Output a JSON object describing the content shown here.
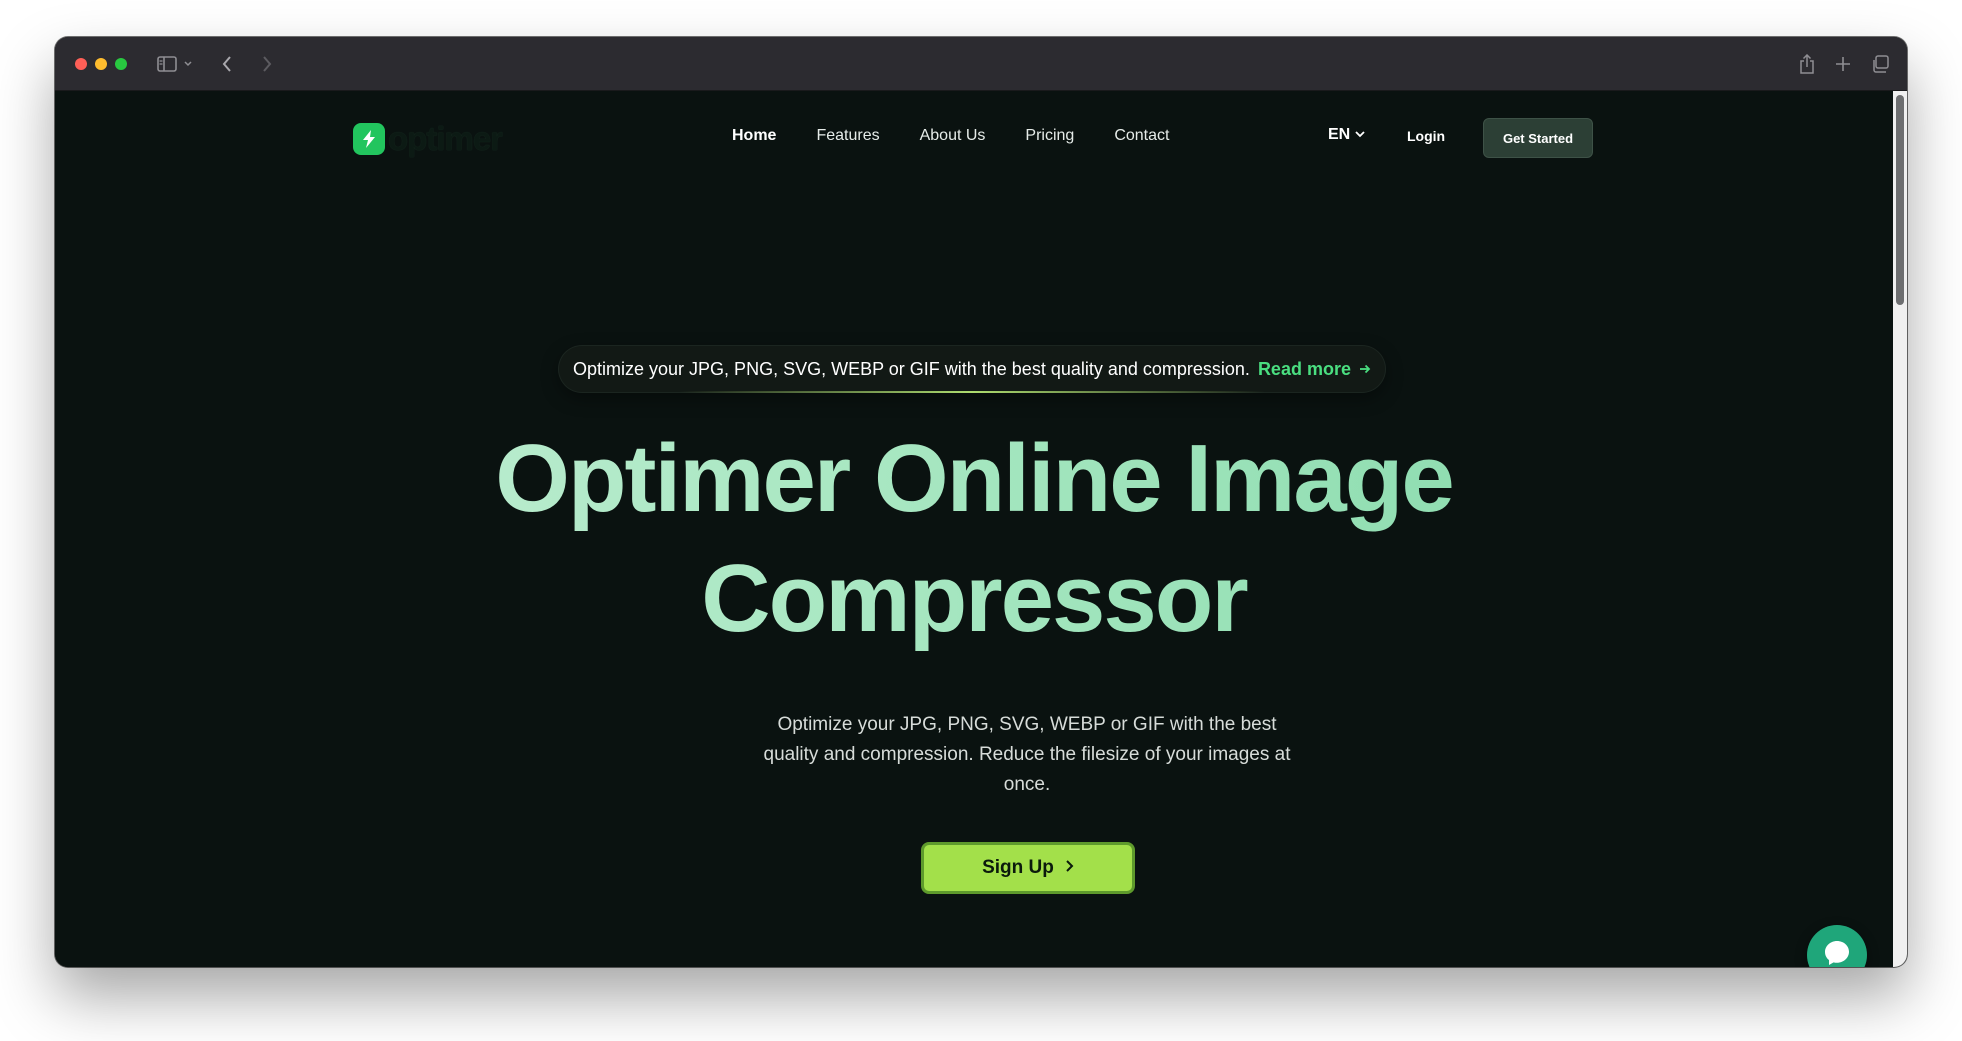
{
  "browser": {
    "icons": [
      "sidebar-icon",
      "chevron-down-icon",
      "back-icon",
      "forward-icon",
      "share-icon",
      "new-tab-icon",
      "tabs-overview-icon"
    ]
  },
  "nav": {
    "logo_text": "optimer",
    "links": [
      {
        "label": "Home",
        "active": true
      },
      {
        "label": "Features"
      },
      {
        "label": "About Us"
      },
      {
        "label": "Pricing"
      },
      {
        "label": "Contact"
      }
    ],
    "language": "EN",
    "login_label": "Login",
    "cta_label": "Get Started"
  },
  "announcement": {
    "text": "Optimize your JPG, PNG, SVG, WEBP or GIF with the best quality and compression.",
    "link_label": "Read more"
  },
  "hero": {
    "title_line1": "Optimer Online Image",
    "title_line2": "Compressor",
    "subtitle": "Optimize your JPG, PNG, SVG, WEBP or GIF with the best quality and compression. Reduce the filesize of your images at once.",
    "signup_label": "Sign Up"
  },
  "colors": {
    "background": "#0a1210",
    "accent_green": "#4ade80",
    "signup_bg": "#a3e04a",
    "cta_bg": "#2c3f35",
    "chat_bg": "#1fa67a",
    "logo_badge": "#22c55e"
  }
}
